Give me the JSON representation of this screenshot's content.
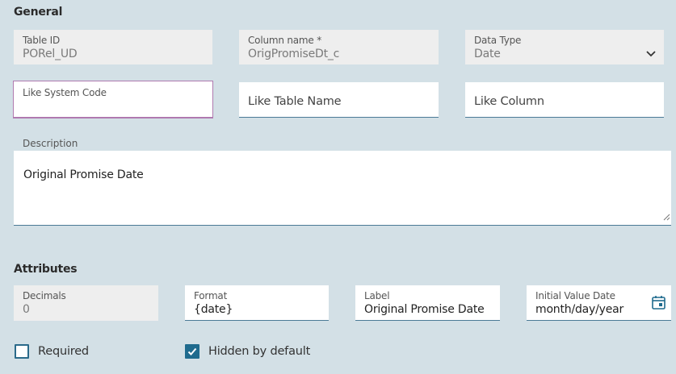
{
  "general": {
    "title": "General",
    "table_id": {
      "label": "Table ID",
      "value": "PORel_UD"
    },
    "column_name": {
      "label": "Column name *",
      "value": "OrigPromiseDt_c"
    },
    "data_type": {
      "label": "Data Type",
      "value": "Date"
    },
    "like_system_code": {
      "label": "Like System Code"
    },
    "like_table_name": {
      "placeholder": "Like Table Name"
    },
    "like_column": {
      "placeholder": "Like Column"
    },
    "description": {
      "label": "Description",
      "value": "Original Promise Date"
    }
  },
  "attributes": {
    "title": "Attributes",
    "decimals": {
      "label": "Decimals",
      "value": "0"
    },
    "format": {
      "label": "Format",
      "value": "{date}"
    },
    "label": {
      "label": "Label",
      "value": "Original Promise Date"
    },
    "initial_value_date": {
      "label": "Initial Value Date",
      "value": "month/day/year"
    },
    "required": {
      "label": "Required",
      "checked": false
    },
    "hidden_by_default": {
      "label": "Hidden by default",
      "checked": true
    }
  },
  "colors": {
    "background": "#d3e0e6",
    "accent": "#1f6b8e",
    "focus_border": "#b07ab0"
  }
}
